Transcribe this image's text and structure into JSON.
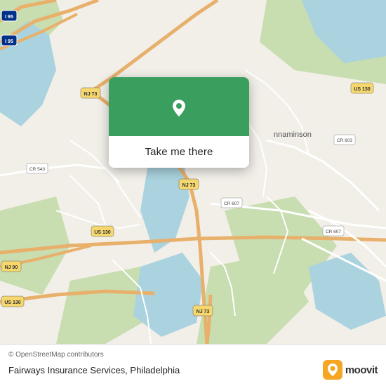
{
  "map": {
    "copyright": "© OpenStreetMap contributors",
    "location_name": "Fairways Insurance Services, Philadelphia"
  },
  "popup": {
    "button_label": "Take me there"
  },
  "moovit": {
    "text": "moovit"
  },
  "colors": {
    "green": "#3a9e5f",
    "map_bg": "#e8e0d8",
    "water": "#aad3df",
    "road_yellow": "#f5d76e",
    "road_white": "#ffffff",
    "road_orange": "#e8b06a",
    "land_light": "#f2efe9",
    "land_green": "#c8ddb0"
  }
}
